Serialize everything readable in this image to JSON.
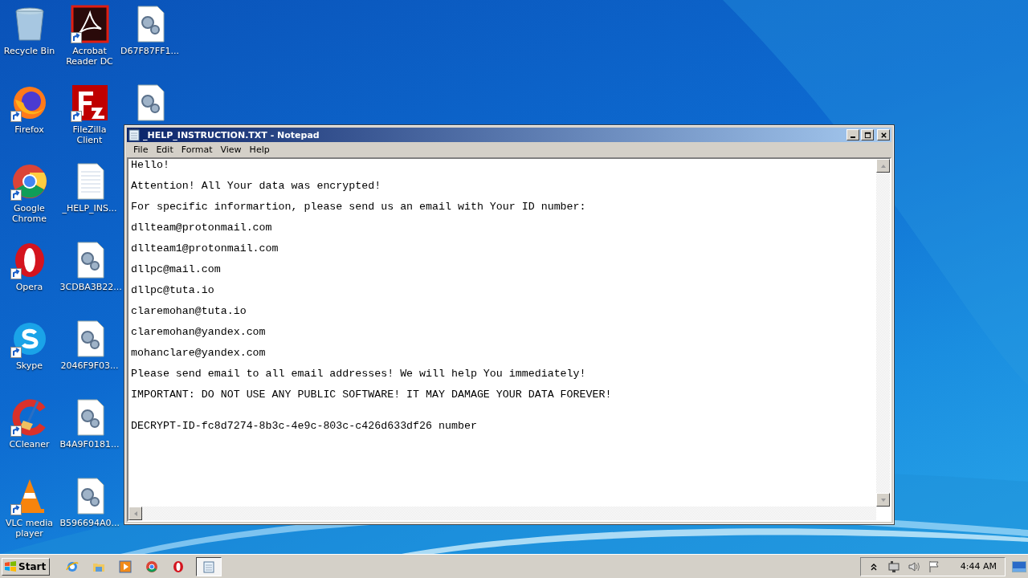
{
  "desktop_icons": [
    {
      "label": "Recycle Bin",
      "kind": "recycle",
      "shortcut": false
    },
    {
      "label": "Firefox",
      "kind": "firefox",
      "shortcut": true
    },
    {
      "label": "Google Chrome",
      "kind": "chrome",
      "shortcut": true
    },
    {
      "label": "Opera",
      "kind": "opera",
      "shortcut": true
    },
    {
      "label": "Skype",
      "kind": "skype",
      "shortcut": true
    },
    {
      "label": "CCleaner",
      "kind": "ccleaner",
      "shortcut": true
    },
    {
      "label": "VLC media player",
      "kind": "vlc",
      "shortcut": true
    },
    {
      "label": "Acrobat Reader DC",
      "kind": "acrobat",
      "shortcut": true
    },
    {
      "label": "FileZilla Client",
      "kind": "filezilla",
      "shortcut": true
    },
    {
      "label": "_HELP_INS...",
      "kind": "text",
      "shortcut": false
    },
    {
      "label": "3CDBA3B22...",
      "kind": "gearfile",
      "shortcut": false
    },
    {
      "label": "2046F9F03...",
      "kind": "gearfile",
      "shortcut": false
    },
    {
      "label": "B4A9F0181...",
      "kind": "gearfile",
      "shortcut": false
    },
    {
      "label": "B596694A0...",
      "kind": "gearfile",
      "shortcut": false
    },
    {
      "label": "D67F87FF1...",
      "kind": "gearfile",
      "shortcut": false
    },
    {
      "kind": "gearfile",
      "shortcut": false
    }
  ],
  "window": {
    "title": "_HELP_INSTRUCTION.TXT - Notepad",
    "menu": [
      "File",
      "Edit",
      "Format",
      "View",
      "Help"
    ],
    "lines": [
      {
        "text": "Hello!",
        "spaced": false
      },
      {
        "text": "Attention! All Your data was encrypted!",
        "spaced": false
      },
      {
        "text": "For specific informartion, please send us an email with Your ID number:",
        "spaced": false
      },
      {
        "text": "dllteam@protonmail.com",
        "spaced": false
      },
      {
        "text": "dllteam1@protonmail.com",
        "spaced": false
      },
      {
        "text": "dllpc@mail.com",
        "spaced": false
      },
      {
        "text": "dllpc@tuta.io",
        "spaced": false
      },
      {
        "text": "claremohan@tuta.io",
        "spaced": false
      },
      {
        "text": "claremohan@yandex.com",
        "spaced": false
      },
      {
        "text": "mohanclare@yandex.com",
        "spaced": false
      },
      {
        "text": "Please send email to all email addresses! We will help You immediately!",
        "spaced": false
      },
      {
        "text": "IMPORTANT: DO NOT USE ANY PUBLIC SOFTWARE! IT MAY DAMAGE YOUR DATA FOREVER!",
        "spaced": false
      },
      {
        "text": "DECRYPT-ID-fc8d7274-8b3c-4e9c-803c-c426d633df26 number",
        "spaced": true
      }
    ]
  },
  "taskbar": {
    "start": "Start",
    "quick_launch": [
      {
        "kind": "ie"
      },
      {
        "kind": "folder"
      },
      {
        "kind": "media"
      },
      {
        "kind": "chrome"
      },
      {
        "kind": "opera"
      }
    ],
    "tasks": [
      {
        "kind": "notepad",
        "selected": true
      }
    ],
    "clock": "4:44 AM"
  }
}
